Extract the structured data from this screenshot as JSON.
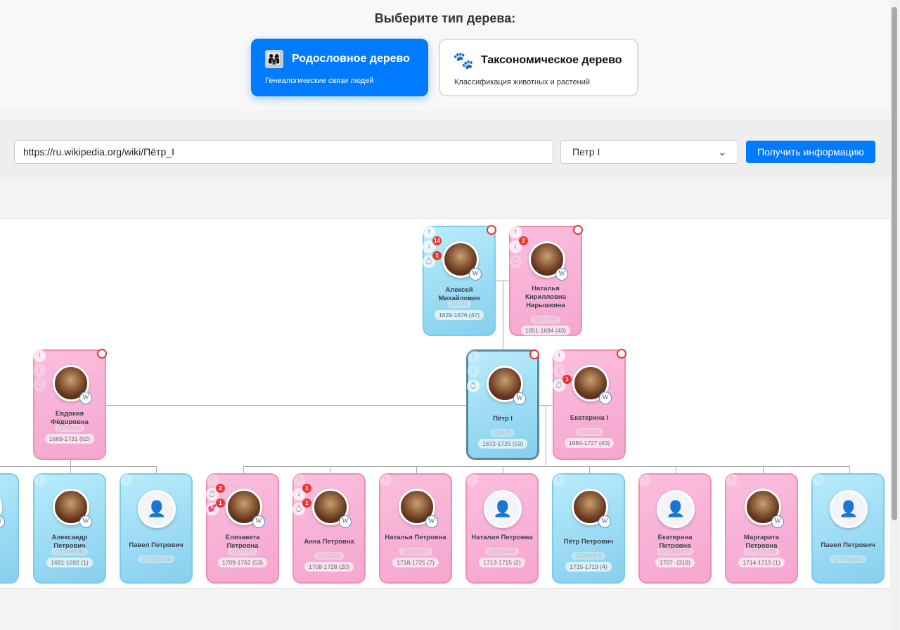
{
  "header": {
    "title": "Выберите тип дерева:",
    "options": [
      {
        "label": "Родословное дерево",
        "desc": "Генеалогические связи людей",
        "icon": "family-icon",
        "active": true
      },
      {
        "label": "Таксономическое дерево",
        "desc": "Классификация животных и растений",
        "icon": "paw-icon",
        "active": false
      }
    ]
  },
  "search": {
    "url": "https://ru.wikipedia.org/wiki/Пётр_I",
    "selected": "Петр I",
    "submit": "Получить информацию"
  },
  "colors": {
    "accent": "#007bff",
    "male": "#86cfee",
    "female": "#f5a6cf",
    "badge": "#e53935"
  },
  "persons": [
    {
      "name": "Алексей Михайлович",
      "qid": "Q7731",
      "dates": "1629-1676 (47)",
      "gender": "m",
      "photo": true,
      "clock": true,
      "ctl": [
        {
          "i": "↑"
        },
        {
          "i": "↓",
          "b": "14"
        },
        {
          "i": "💍",
          "b": "1"
        }
      ]
    },
    {
      "name": "Наталья Кирилловна Нарышкина",
      "qid": "Q241797",
      "dates": "1651-1694 (43)",
      "gender": "f",
      "photo": true,
      "clock": true,
      "ctl": [
        {
          "i": "↑"
        },
        {
          "i": "↓",
          "b": "2"
        },
        {
          "i": "💍",
          "fd": true
        }
      ]
    },
    {
      "name": "Евдокия Фёдоровна",
      "qid": "Q240145",
      "dates": "1669-1731 (62)",
      "gender": "f",
      "photo": true,
      "clock": true,
      "ctl": [
        {
          "i": "↑"
        },
        {
          "i": "↓",
          "fd": true
        },
        {
          "i": "💍",
          "fd": true
        }
      ]
    },
    {
      "name": "Пётр I",
      "qid": "Q8479",
      "dates": "1672-1725 (53)",
      "gender": "m",
      "photo": true,
      "clock": true,
      "selected": true,
      "ctl": [
        {
          "i": "↑",
          "fd": true
        },
        {
          "i": "↓",
          "fd": true
        },
        {
          "i": "💍"
        }
      ]
    },
    {
      "name": "Екатерина I",
      "qid": "Q15208",
      "dates": "1684-1727 (43)",
      "gender": "f",
      "photo": true,
      "clock": true,
      "ctl": [
        {
          "i": "↑"
        },
        {
          "i": "↓",
          "fd": true
        },
        {
          "i": "💍",
          "b": "1"
        }
      ]
    },
    {
      "name": "",
      "qid": "",
      "dates": "8)",
      "gender": "m",
      "photo": true,
      "ctl": []
    },
    {
      "name": "Александр Петрович",
      "qid": "Q26299695",
      "dates": "1691-1692 (1)",
      "gender": "m",
      "photo": true,
      "ctl": [
        {
          "i": "↑",
          "fd": true
        }
      ]
    },
    {
      "name": "Павел Петрович",
      "qid": "Q75385478",
      "dates": "",
      "gender": "m",
      "photo": false,
      "ctl": [
        {
          "i": "↑",
          "fd": true
        }
      ]
    },
    {
      "name": "Елизавета Петровна",
      "qid": "Q130752",
      "dates": "1709-1762 (53)",
      "gender": "f",
      "photo": true,
      "ctl": [
        {
          "i": "↑",
          "fd": true
        },
        {
          "i": "💍",
          "b": "2"
        },
        {
          "i": "💕",
          "b": "1"
        }
      ]
    },
    {
      "name": "Анна Петровна",
      "qid": "Q153319",
      "dates": "1708-1728 (20)",
      "gender": "f",
      "photo": true,
      "ctl": [
        {
          "i": "↑",
          "fd": true
        },
        {
          "i": "↓",
          "b": "1"
        },
        {
          "i": "💍",
          "b": "1"
        }
      ]
    },
    {
      "name": "Наталья Петровна",
      "qid": "Q2839457",
      "dates": "1718-1725 (7)",
      "gender": "f",
      "photo": true,
      "ctl": [
        {
          "i": "↑",
          "fd": true
        }
      ]
    },
    {
      "name": "Наталия Петровна",
      "qid": "Q3825468",
      "dates": "1713-1715 (2)",
      "gender": "f",
      "photo": false,
      "ctl": [
        {
          "i": "↑",
          "fd": true
        }
      ]
    },
    {
      "name": "Пётр Петрович",
      "qid": "Q4386209",
      "dates": "1715-1719 (4)",
      "gender": "m",
      "photo": true,
      "ctl": [
        {
          "i": "↑",
          "fd": true
        }
      ]
    },
    {
      "name": "Екатерина Петровна",
      "qid": "Q75385479",
      "dates": "1707- (318)",
      "gender": "f",
      "photo": false,
      "ctl": [
        {
          "i": "↑",
          "fd": true
        }
      ]
    },
    {
      "name": "Маргарита Петровна",
      "qid": "Q75385482",
      "dates": "1714-1715 (1)",
      "gender": "f",
      "photo": true,
      "ctl": [
        {
          "i": "↑",
          "fd": true
        }
      ]
    },
    {
      "name": "Павел Петрович",
      "qid": "Q75385485",
      "dates": "",
      "gender": "m",
      "photo": false,
      "ctl": [
        {
          "i": "↑",
          "fd": true
        }
      ]
    }
  ]
}
